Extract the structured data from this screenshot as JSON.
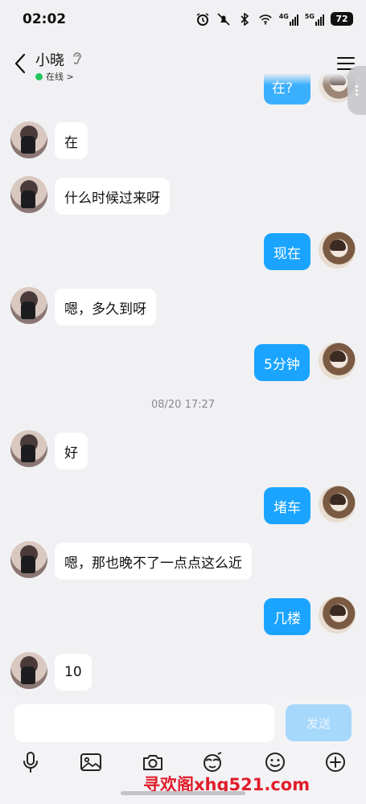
{
  "status_bar": {
    "time": "02:02",
    "battery": "72",
    "network1": "4G",
    "network2": "5G"
  },
  "header": {
    "contact_name": "小晓",
    "online_label": "在线 >"
  },
  "messages": [
    {
      "side": "out",
      "text": "在?",
      "partial": true
    },
    {
      "side": "in",
      "text": "在"
    },
    {
      "side": "in",
      "text": "什么时候过来呀"
    },
    {
      "side": "out",
      "text": "现在"
    },
    {
      "side": "in",
      "text": "嗯，多久到呀"
    },
    {
      "side": "out",
      "text": "5分钟"
    },
    {
      "type": "timestamp",
      "text": "08/20 17:27"
    },
    {
      "side": "in",
      "text": "好"
    },
    {
      "side": "out",
      "text": "堵车"
    },
    {
      "side": "in",
      "text": "嗯，那也晚不了一点点这么近"
    },
    {
      "side": "out",
      "text": "几楼"
    },
    {
      "side": "in",
      "text": "10"
    }
  ],
  "composer": {
    "input_value": "",
    "send_label": "发送"
  },
  "toolbar": {
    "icons": [
      "microphone-icon",
      "image-icon",
      "camera-icon",
      "mask-icon",
      "emoji-icon",
      "plus-icon"
    ]
  },
  "watermark": "寻欢阁xhg521.com",
  "colors": {
    "outgoing_bubble": "#1aa4ff",
    "incoming_bubble": "#ffffff",
    "send_button_disabled": "#a6d8fb",
    "online_dot": "#22c55e",
    "watermark": "#e11d2a"
  }
}
